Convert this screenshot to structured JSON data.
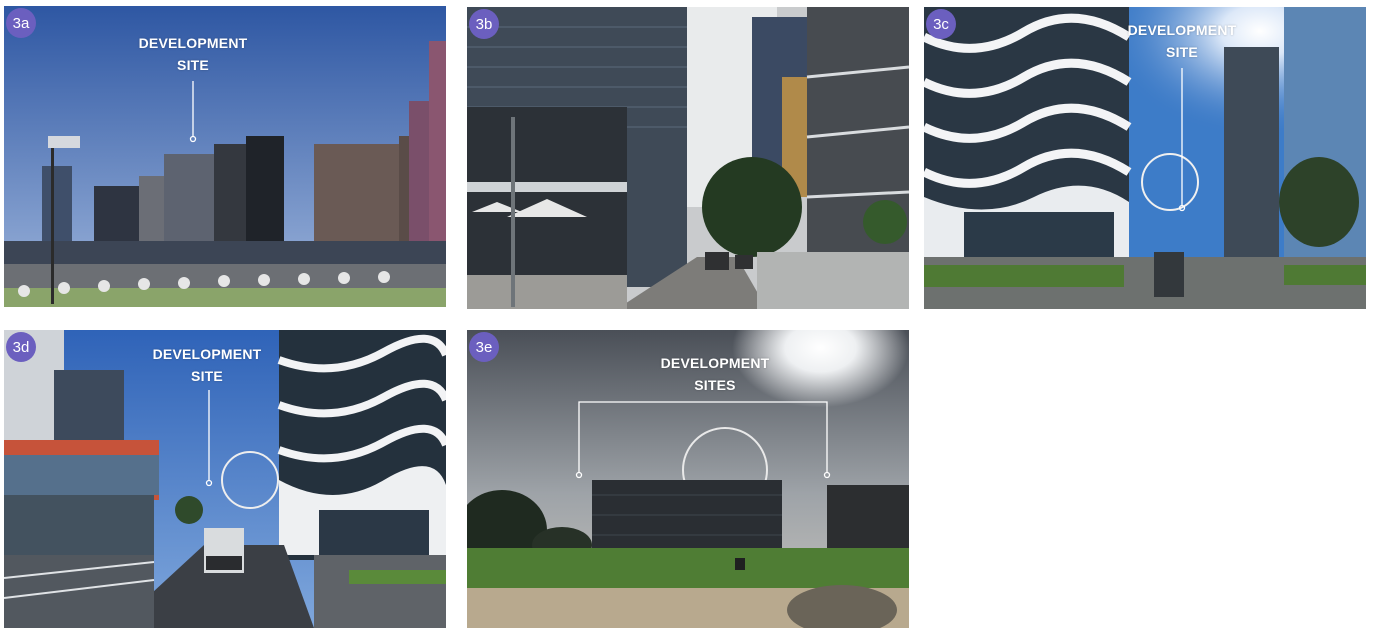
{
  "photos": [
    {
      "badge": "3a",
      "label_line1": "DEVELOPMENT",
      "label_line2": "SITE"
    },
    {
      "badge": "3b"
    },
    {
      "badge": "3c",
      "label_line1": "DEVELOPMENT",
      "label_line2": "SITE"
    },
    {
      "badge": "3d",
      "label_line1": "DEVELOPMENT",
      "label_line2": "SITE"
    },
    {
      "badge": "3e",
      "label_line1": "DEVELOPMENT",
      "label_line2": "SITES"
    }
  ],
  "colors": {
    "badge": "#6b5fbf",
    "label": "#ffffff",
    "sky": "#4f78b8",
    "grass": "#5e8a3a"
  }
}
